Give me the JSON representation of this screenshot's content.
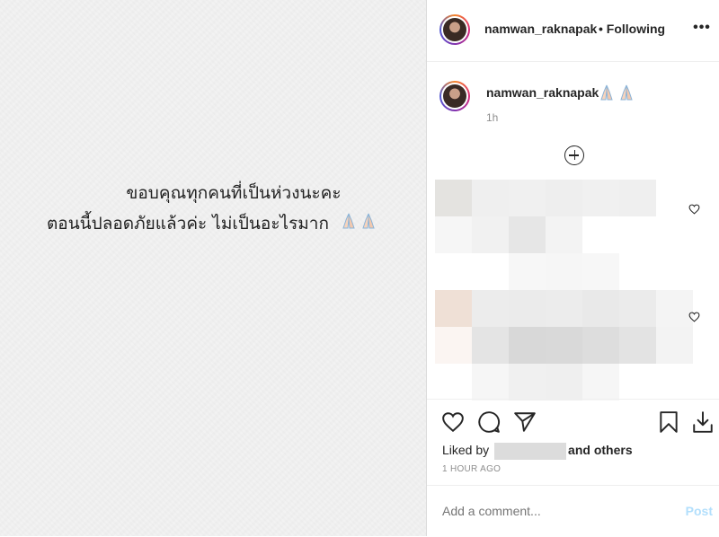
{
  "image": {
    "caption_line1": "ขอบคุณทุกคนที่เป็นห่วงนะคะ",
    "caption_line2": "ตอนนี้ปลอดภัยแล้วค่ะ ไม่เป็นอะไรมาก"
  },
  "header": {
    "username": "namwan_raknapak",
    "following": "• Following",
    "more": "•••"
  },
  "caption": {
    "username": "namwan_raknapak",
    "time": "1h"
  },
  "actions": {
    "liked_by": "Liked by",
    "and_others": "and others",
    "timestamp": "1 HOUR AGO"
  },
  "comment_box": {
    "placeholder": "Add a comment...",
    "post": "Post"
  },
  "icons": [
    "heart-icon",
    "comment-icon",
    "share-icon",
    "bookmark-icon",
    "download-icon",
    "plus-circle-icon",
    "more-icon",
    "praying-hands-emoji"
  ]
}
